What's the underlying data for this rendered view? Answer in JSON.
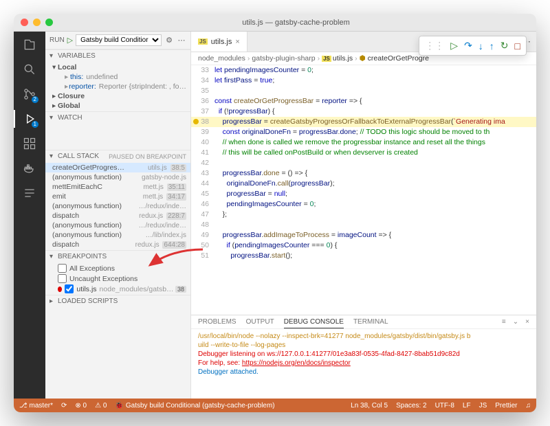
{
  "window_title": "utils.js — gatsby-cache-problem",
  "run": {
    "label": "RUN",
    "config": "Gatsby build Conditior"
  },
  "activity": {
    "explorer": "explorer",
    "search": "search",
    "scm": "scm",
    "debug": "debug",
    "ext": "extensions",
    "docker": "docker",
    "outline": "outline",
    "scm_badge": "2",
    "debug_badge": "1"
  },
  "variables": {
    "title": "VARIABLES",
    "scopes": [
      {
        "name": "Local",
        "open": true,
        "vars": [
          {
            "k": "this:",
            "v": "undefined"
          },
          {
            "k": "reporter:",
            "v": "Reporter {stripIndent: , fo…"
          }
        ]
      },
      {
        "name": "Closure",
        "open": false
      },
      {
        "name": "Global",
        "open": false
      }
    ]
  },
  "watch": {
    "title": "WATCH"
  },
  "callstack": {
    "title": "CALL STACK",
    "status": "PAUSED ON BREAKPOINT",
    "frames": [
      {
        "fn": "createOrGetProgressBar",
        "file": "utils.js",
        "ln": "38:5",
        "sel": true
      },
      {
        "fn": "(anonymous function)",
        "file": "gatsby-node.js",
        "ln": ""
      },
      {
        "fn": "mettEmitEachC",
        "file": "mett.js",
        "ln": "35:11"
      },
      {
        "fn": "emit",
        "file": "mett.js",
        "ln": "34:17"
      },
      {
        "fn": "(anonymous function)",
        "file": "…/redux/inde…",
        "ln": ""
      },
      {
        "fn": "dispatch",
        "file": "redux.js",
        "ln": "228:7"
      },
      {
        "fn": "(anonymous function)",
        "file": "…/redux/inde…",
        "ln": ""
      },
      {
        "fn": "(anonymous function)",
        "file": "…/lib/index.js",
        "ln": ""
      },
      {
        "fn": "dispatch",
        "file": "redux.js",
        "ln": "644:28"
      }
    ]
  },
  "breakpoints": {
    "title": "BREAKPOINTS",
    "builtin": [
      {
        "label": "All Exceptions",
        "checked": false
      },
      {
        "label": "Uncaught Exceptions",
        "checked": false
      }
    ],
    "user": {
      "file": "utils.js",
      "path": "node_modules/gatsby-plugi…",
      "ln": "38"
    }
  },
  "loaded": {
    "title": "LOADED SCRIPTS"
  },
  "tab": {
    "icon": "JS",
    "name": "utils.js"
  },
  "tabicons": {
    "a": "◆",
    "b": "⟲",
    "c": "◯",
    "d": "▷",
    "e": "▥",
    "f": "⋯"
  },
  "crumbs": [
    "node_modules",
    "gatsby-plugin-sharp",
    "utils.js",
    "createOrGetProgre"
  ],
  "dbgtb": {
    "grip": "⋮⋮",
    "cont": "▷",
    "over": "↷",
    "in": "↓",
    "out": "↑",
    "restart": "↻",
    "stop": "□"
  },
  "editor": {
    "lines": [
      {
        "n": 33,
        "html": "<span class='kw'>let</span> <span class='prop'>pendingImagesCounter</span> = <span class='num'>0</span>;"
      },
      {
        "n": 34,
        "html": "<span class='kw'>let</span> <span class='prop'>firstPass</span> = <span class='kw'>true</span>;"
      },
      {
        "n": 35,
        "html": ""
      },
      {
        "n": 36,
        "html": "<span class='kw'>const</span> <span class='fnname'>createOrGetProgressBar</span> = <span class='prop'>reporter</span> <span class='op'>=&gt;</span> {"
      },
      {
        "n": 37,
        "html": "  <span class='kw'>if</span> (!<span class='prop'>progressBar</span>) {"
      },
      {
        "n": 38,
        "hl": true,
        "bp": "#e6b800",
        "html": "    <span class='prop'>progressBar</span> = <span class='fnname'>createGatsbyProgressOrFallbackToExternalProgressBar</span>(<span class='str'>`Generating ima</span>"
      },
      {
        "n": 39,
        "html": "    <span class='kw'>const</span> <span class='prop'>originalDoneFn</span> = <span class='prop'>progressBar</span>.<span class='prop'>done</span>; <span class='cm'>// TODO this logic should be moved to th</span>"
      },
      {
        "n": 40,
        "html": "    <span class='cm'>// when done is called we remove the progressbar instance and reset all the things</span>"
      },
      {
        "n": 41,
        "html": "    <span class='cm'>// this will be called onPostBuild or when devserver is created</span>"
      },
      {
        "n": 42,
        "html": ""
      },
      {
        "n": 43,
        "html": "    <span class='prop'>progressBar</span>.<span class='fnname'>done</span> = () <span class='op'>=&gt;</span> {"
      },
      {
        "n": 44,
        "html": "      <span class='prop'>originalDoneFn</span>.<span class='fnname'>call</span>(<span class='prop'>progressBar</span>);"
      },
      {
        "n": 45,
        "html": "      <span class='prop'>progressBar</span> = <span class='kw'>null</span>;"
      },
      {
        "n": 46,
        "html": "      <span class='prop'>pendingImagesCounter</span> = <span class='num'>0</span>;"
      },
      {
        "n": 47,
        "html": "    };"
      },
      {
        "n": 48,
        "html": ""
      },
      {
        "n": 49,
        "html": "    <span class='prop'>progressBar</span>.<span class='fnname'>addImageToProcess</span> = <span class='prop'>imageCount</span> <span class='op'>=&gt;</span> {"
      },
      {
        "n": 50,
        "html": "      <span class='kw'>if</span> (<span class='prop'>pendingImagesCounter</span> === <span class='num'>0</span>) {"
      },
      {
        "n": 51,
        "html": "        <span class='prop'>progressBar</span>.<span class='fnname'>start</span>();"
      }
    ]
  },
  "panel": {
    "tabs": [
      "PROBLEMS",
      "OUTPUT",
      "DEBUG CONSOLE",
      "TERMINAL"
    ],
    "active": 2,
    "cmd": "/usr/local/bin/node --nolazy --inspect-brk=41277 node_modules/gatsby/dist/bin/gatsby.js b\nuild --write-to-file --log-pages",
    "ws1": "Debugger listening on ws://127.0.0.1:41277/01e3a83f-0535-4fad-8427-8bab51d9c82d",
    "ws2a": "For help, see: ",
    "ws2b": "https://nodejs.org/en/docs/inspector",
    "att": "Debugger attached."
  },
  "status": {
    "branch": "master*",
    "sync": "⟳",
    "err": "⊗ 0",
    "warn": "⚠ 0",
    "debug": "Gatsby build Conditional (gatsby-cache-problem)",
    "lncol": "Ln 38, Col 5",
    "spaces": "Spaces: 2",
    "enc": "UTF-8",
    "eol": "LF",
    "lang": "JS",
    "prettier": "Prettier",
    "bell": "♫"
  }
}
